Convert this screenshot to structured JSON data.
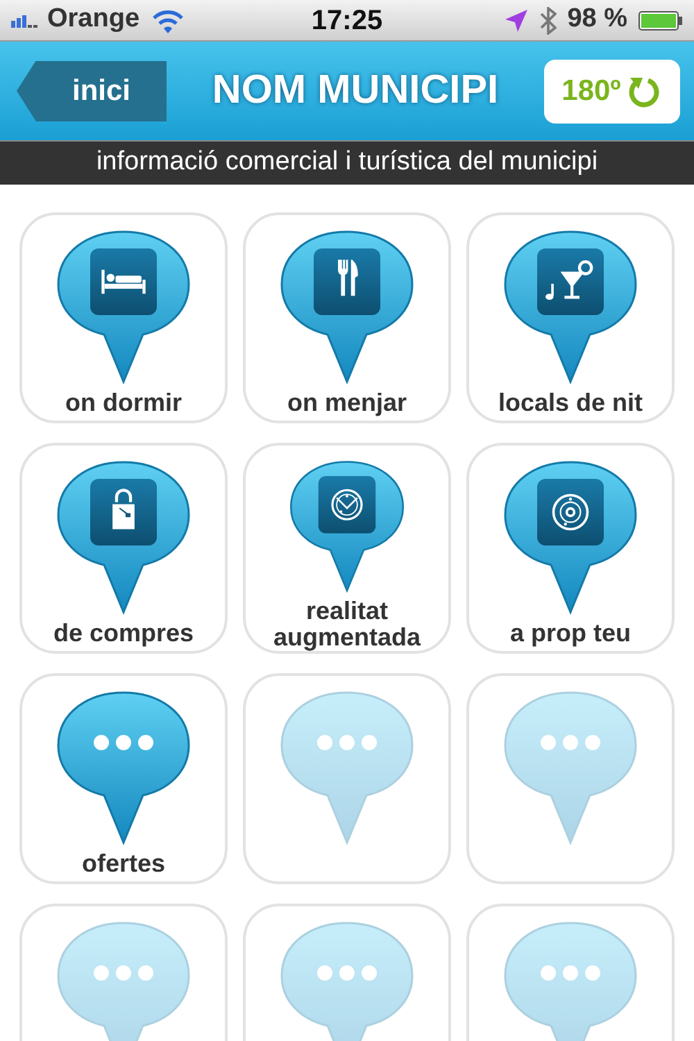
{
  "status_bar": {
    "carrier": "Orange",
    "time": "17:25",
    "battery": "98 %"
  },
  "header": {
    "back": "inici",
    "title": "NOM MUNICIPI",
    "rotate": "180º"
  },
  "subtitle": "informació comercial i turística del municipi",
  "tiles": [
    {
      "kind": "bed",
      "label": "on dormir",
      "disabled": false
    },
    {
      "kind": "cutlery",
      "label": "on menjar",
      "disabled": false
    },
    {
      "kind": "cocktail",
      "label": "locals de nit",
      "disabled": false
    },
    {
      "kind": "bag",
      "label": "de compres",
      "disabled": false
    },
    {
      "kind": "radar",
      "label": "realitat augmentada",
      "disabled": false
    },
    {
      "kind": "target",
      "label": "a prop teu",
      "disabled": false
    },
    {
      "kind": "dots",
      "label": "ofertes",
      "disabled": false
    },
    {
      "kind": "dots",
      "disabled": true
    },
    {
      "kind": "dots",
      "disabled": true
    },
    {
      "kind": "dots",
      "disabled": true
    },
    {
      "kind": "dots",
      "disabled": true
    },
    {
      "kind": "dots",
      "disabled": true
    }
  ]
}
